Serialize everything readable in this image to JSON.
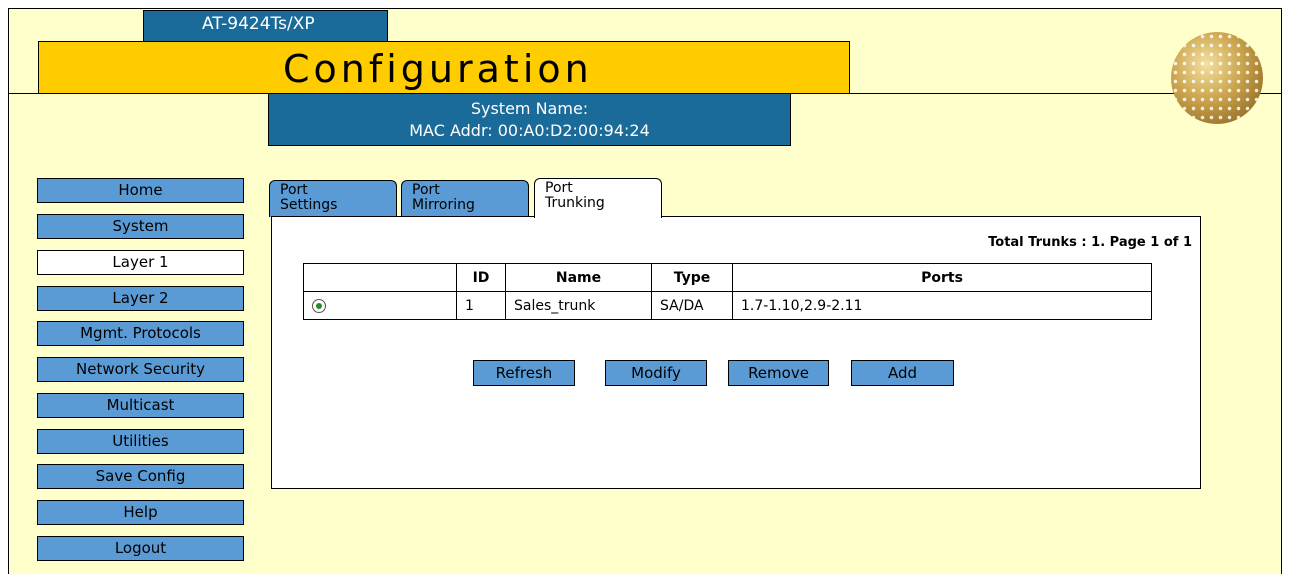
{
  "header": {
    "model": "AT-9424Ts/XP",
    "title": "Configuration",
    "system_name_label": "System Name:",
    "mac_label": "MAC Addr: 00:A0:D2:00:94:24"
  },
  "nav": {
    "items": [
      {
        "label": "Home",
        "active": false
      },
      {
        "label": "System",
        "active": false
      },
      {
        "label": "Layer 1",
        "active": true
      },
      {
        "label": "Layer 2",
        "active": false
      },
      {
        "label": "Mgmt. Protocols",
        "active": false
      },
      {
        "label": "Network Security",
        "active": false
      },
      {
        "label": "Multicast",
        "active": false
      },
      {
        "label": "Utilities",
        "active": false
      },
      {
        "label": "Save Config",
        "active": false
      },
      {
        "label": "Help",
        "active": false
      },
      {
        "label": "Logout",
        "active": false
      }
    ]
  },
  "tabs": [
    {
      "line1": "Port",
      "line2": "Settings"
    },
    {
      "line1": "Port",
      "line2": "Mirroring"
    },
    {
      "line1": "Port",
      "line2": "Trunking"
    }
  ],
  "panel": {
    "total": "Total Trunks : 1. Page 1 of 1",
    "columns": [
      "",
      "ID",
      "Name",
      "Type",
      "Ports"
    ],
    "rows": [
      {
        "id": "1",
        "name": "Sales_trunk",
        "type": "SA/DA",
        "ports": "1.7-1.10,2.9-2.11",
        "selected": true
      }
    ],
    "buttons": {
      "refresh": "Refresh",
      "modify": "Modify",
      "remove": "Remove",
      "add": "Add"
    }
  },
  "colors": {
    "background": "#ffffcc",
    "accent": "#ffcc00",
    "blue": "#1a6b99",
    "nav_blue": "#5b9bd5"
  }
}
